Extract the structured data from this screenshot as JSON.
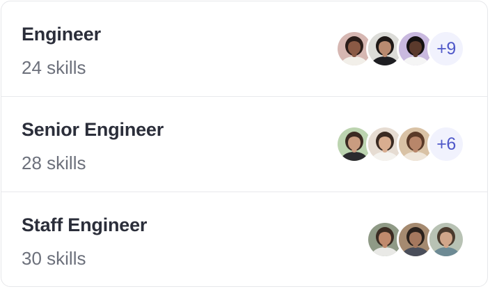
{
  "roles": [
    {
      "title": "Engineer",
      "skills": "24 skills",
      "extra": "+9",
      "avatars": [
        {
          "name": "avatar-1",
          "bg": "#d6b7b2",
          "skin": "#8a5a45",
          "hair": "#2a1d19",
          "shirt": "#f2efe9"
        },
        {
          "name": "avatar-2",
          "bg": "#dcdcd8",
          "skin": "#b98a70",
          "hair": "#1f1917",
          "shirt": "#1e1e22"
        },
        {
          "name": "avatar-3",
          "bg": "#c9b9df",
          "skin": "#5b3a2c",
          "hair": "#161212",
          "shirt": "#f5f5f5"
        }
      ]
    },
    {
      "title": "Senior Engineer",
      "skills": "28 skills",
      "extra": "+6",
      "avatars": [
        {
          "name": "avatar-4",
          "bg": "#bcd4b0",
          "skin": "#c99c80",
          "hair": "#3b2a22",
          "shirt": "#2b2b2e"
        },
        {
          "name": "avatar-5",
          "bg": "#e6dcd2",
          "skin": "#d8ad90",
          "hair": "#3a2a22",
          "shirt": "#f4f2ee"
        },
        {
          "name": "avatar-6",
          "bg": "#d9c2a5",
          "skin": "#b8866a",
          "hair": "#5a3a28",
          "shirt": "#efe6da"
        }
      ]
    },
    {
      "title": "Staff Engineer",
      "skills": "30 skills",
      "extra": "",
      "avatars": [
        {
          "name": "avatar-7",
          "bg": "#8f9a86",
          "skin": "#c08a6d",
          "hair": "#3a2b22",
          "shirt": "#e9e9e6"
        },
        {
          "name": "avatar-8",
          "bg": "#a58a70",
          "skin": "#a5785e",
          "hair": "#2b221d",
          "shirt": "#4a4e5a"
        },
        {
          "name": "avatar-9",
          "bg": "#b8c2b4",
          "skin": "#d1a68a",
          "hair": "#4b3b2e",
          "shirt": "#6d8a94"
        }
      ]
    }
  ]
}
